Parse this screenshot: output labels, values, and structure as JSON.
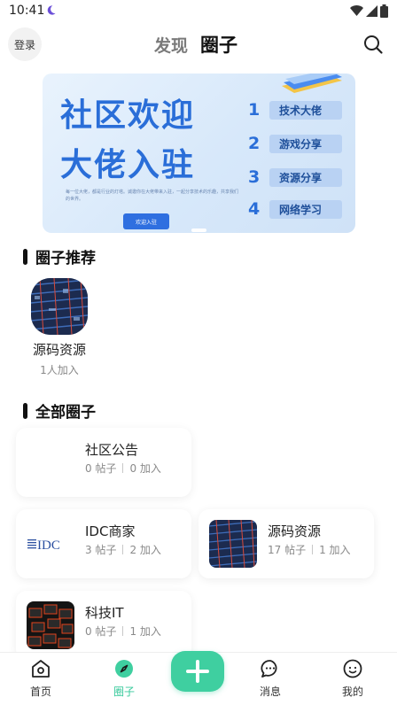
{
  "status_bar": {
    "time": "10:41"
  },
  "header": {
    "login_label": "登录",
    "tabs": [
      {
        "label": "发现",
        "active": false
      },
      {
        "label": "圈子",
        "active": true
      }
    ]
  },
  "banner": {
    "line1": "社区欢迎",
    "line2": "大佬入驻",
    "description": "每一位大佬，都是行业的灯塔。诚邀你在大佬带来入驻，一起分享技术的乐趣，共享我们的世界。",
    "cta": "欢迎入驻",
    "items": [
      {
        "num": "1",
        "label": "技术大佬"
      },
      {
        "num": "2",
        "label": "游戏分享"
      },
      {
        "num": "3",
        "label": "资源分享"
      },
      {
        "num": "4",
        "label": "网络学习"
      }
    ]
  },
  "recommended": {
    "title": "圈子推荐",
    "items": [
      {
        "name": "源码资源",
        "meta": "1人加入"
      }
    ]
  },
  "all_circles": {
    "title": "全部圈子",
    "items": [
      {
        "name": "社区公告",
        "posts": "0 帖子",
        "joins": "0 加入",
        "logo": "none"
      },
      {
        "name": "IDC商家",
        "posts": "3 帖子",
        "joins": "2 加入",
        "logo": "idc-logo"
      },
      {
        "name": "源码资源",
        "posts": "17 帖子",
        "joins": "1 加入",
        "logo": "city-image"
      },
      {
        "name": "科技IT",
        "posts": "0 帖子",
        "joins": "1 加入",
        "logo": "tech-cubes-image"
      }
    ]
  },
  "bottom_nav": {
    "items": [
      {
        "label": "首页",
        "active": false
      },
      {
        "label": "圈子",
        "active": true
      },
      {
        "label": "消息",
        "active": false
      },
      {
        "label": "我的",
        "active": false
      }
    ],
    "accent_color": "#3fcfa0"
  }
}
